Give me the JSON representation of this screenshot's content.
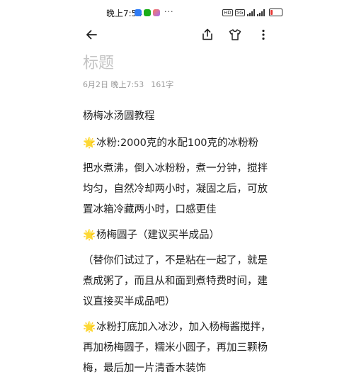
{
  "status_bar": {
    "time": "晚上7:54",
    "more": "···",
    "network_badge": "5G",
    "battery": "19",
    "battery_level": 0.19,
    "battery_color": "#e53935",
    "app_icons": [
      "chat-app-icon",
      "wechat-icon",
      "gallery-icon"
    ]
  },
  "toolbar": {
    "back_icon": "back-arrow-icon",
    "share_icon": "share-icon",
    "theme_icon": "tshirt-icon",
    "more_icon": "more-vertical-icon"
  },
  "note": {
    "title_placeholder": "标题",
    "date": "6月2日 晚上7:53",
    "word_count": "161字",
    "paragraphs": [
      {
        "emoji": "",
        "text": "杨梅冰汤圆教程"
      },
      {
        "emoji": "🌟",
        "text": "冰粉:2000克的水配100克的冰粉粉"
      },
      {
        "emoji": "",
        "text": "把水煮沸，倒入冰粉粉，煮一分钟，搅拌均匀，自然冷却两小时，凝固之后，可放置冰箱冷藏两小时，口感更佳"
      },
      {
        "emoji": "🌟",
        "text": "杨梅圆子（建议买半成品）"
      },
      {
        "emoji": "",
        "text": "（替你们试过了，不是粘在一起了，就是煮成粥了，而且从和面到煮特费时间，建议直接买半成品吧）"
      },
      {
        "emoji": "🌟",
        "text": "冰粉打底加入冰沙，加入杨梅酱搅拌，再加杨梅圆子，糯米小圆子，再加三颗杨梅，最后加一片清香木装饰"
      }
    ]
  },
  "colors": {
    "accent_sun": "#f6b320",
    "title_placeholder": "#c4c4c4",
    "meta": "#9a9a9a"
  }
}
